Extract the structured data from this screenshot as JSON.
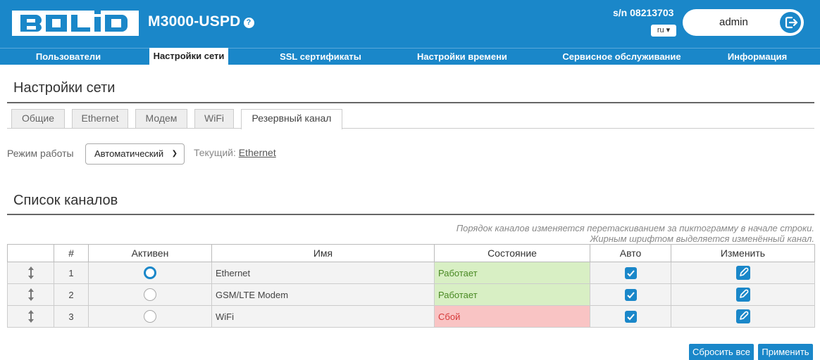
{
  "header": {
    "logo_text": "BOLID",
    "product": "M3000-USPD",
    "help_icon": "help-icon",
    "serial": "s/n 08213703",
    "language": "ru",
    "user": "admin",
    "brand_color": "#1a87c9"
  },
  "nav": {
    "items": [
      "Пользователи",
      "Настройки сети",
      "SSL сертификаты",
      "Настройки времени",
      "Сервисное обслуживание",
      "Информация"
    ],
    "active": "Настройки сети"
  },
  "page": {
    "title": "Настройки сети"
  },
  "tabs": {
    "items": [
      "Общие",
      "Ethernet",
      "Модем",
      "WiFi",
      "Резервный канал"
    ],
    "active": "Резервный канал"
  },
  "mode": {
    "label": "Режим работы",
    "value": "Автоматический",
    "current_label": "Текущий:",
    "current_value": "Ethernet"
  },
  "channels": {
    "title": "Список каналов",
    "hint_line1": "Порядок каналов изменяется перетаскиванием за пиктограмму в начале строки.",
    "hint_line2": "Жирным шрифтом выделяется изменённый канал.",
    "columns": [
      "",
      "#",
      "Активен",
      "Имя",
      "Состояние",
      "Авто",
      "Изменить"
    ],
    "rows": [
      {
        "num": "1",
        "active": true,
        "name": "Ethernet",
        "state": "Работает",
        "state_kind": "ok",
        "auto": true
      },
      {
        "num": "2",
        "active": false,
        "name": "GSM/LTE Modem",
        "state": "Работает",
        "state_kind": "ok",
        "auto": true
      },
      {
        "num": "3",
        "active": false,
        "name": "WiFi",
        "state": "Сбой",
        "state_kind": "fail",
        "auto": true
      }
    ]
  },
  "buttons": {
    "reset": "Сбросить все",
    "apply": "Применить"
  }
}
